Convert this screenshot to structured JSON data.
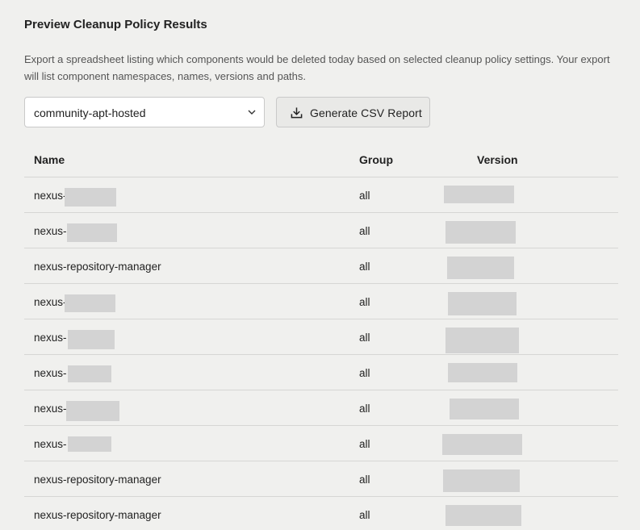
{
  "page": {
    "title": "Preview Cleanup Policy Results",
    "description": "Export a spreadsheet listing which components would be deleted today based on selected cleanup policy settings. Your export will list component namespaces, names, versions and paths."
  },
  "repository_select": {
    "value": "community-apt-hosted"
  },
  "generate_button": {
    "label": "Generate CSV Report",
    "icon": "download-icon"
  },
  "table": {
    "headers": {
      "name": "Name",
      "group": "Group",
      "version": "Version"
    },
    "rows": [
      {
        "name": "nexus-",
        "group": "all",
        "name_redacted": true,
        "version_redacted": true
      },
      {
        "name": "nexus-",
        "group": "all",
        "name_redacted": true,
        "version_redacted": true
      },
      {
        "name": "nexus-repository-manager",
        "group": "all",
        "name_redacted": false,
        "version_redacted": true
      },
      {
        "name": "nexus-",
        "group": "all",
        "name_redacted": true,
        "version_redacted": true
      },
      {
        "name": "nexus-",
        "group": "all",
        "name_redacted": true,
        "version_redacted": true
      },
      {
        "name": "nexus-",
        "group": "all",
        "name_redacted": true,
        "version_redacted": true
      },
      {
        "name": "nexus-",
        "group": "all",
        "name_redacted": true,
        "version_redacted": true
      },
      {
        "name": "nexus-",
        "group": "all",
        "name_redacted": true,
        "version_redacted": true
      },
      {
        "name": "nexus-repository-manager",
        "group": "all",
        "name_redacted": false,
        "version_redacted": true
      },
      {
        "name": "nexus-repository-manager",
        "group": "all",
        "name_redacted": false,
        "version_redacted": true
      }
    ]
  },
  "colors": {
    "background": "#f0f0ee",
    "redaction": "#d3d3d3",
    "divider": "#d6d6d4"
  }
}
